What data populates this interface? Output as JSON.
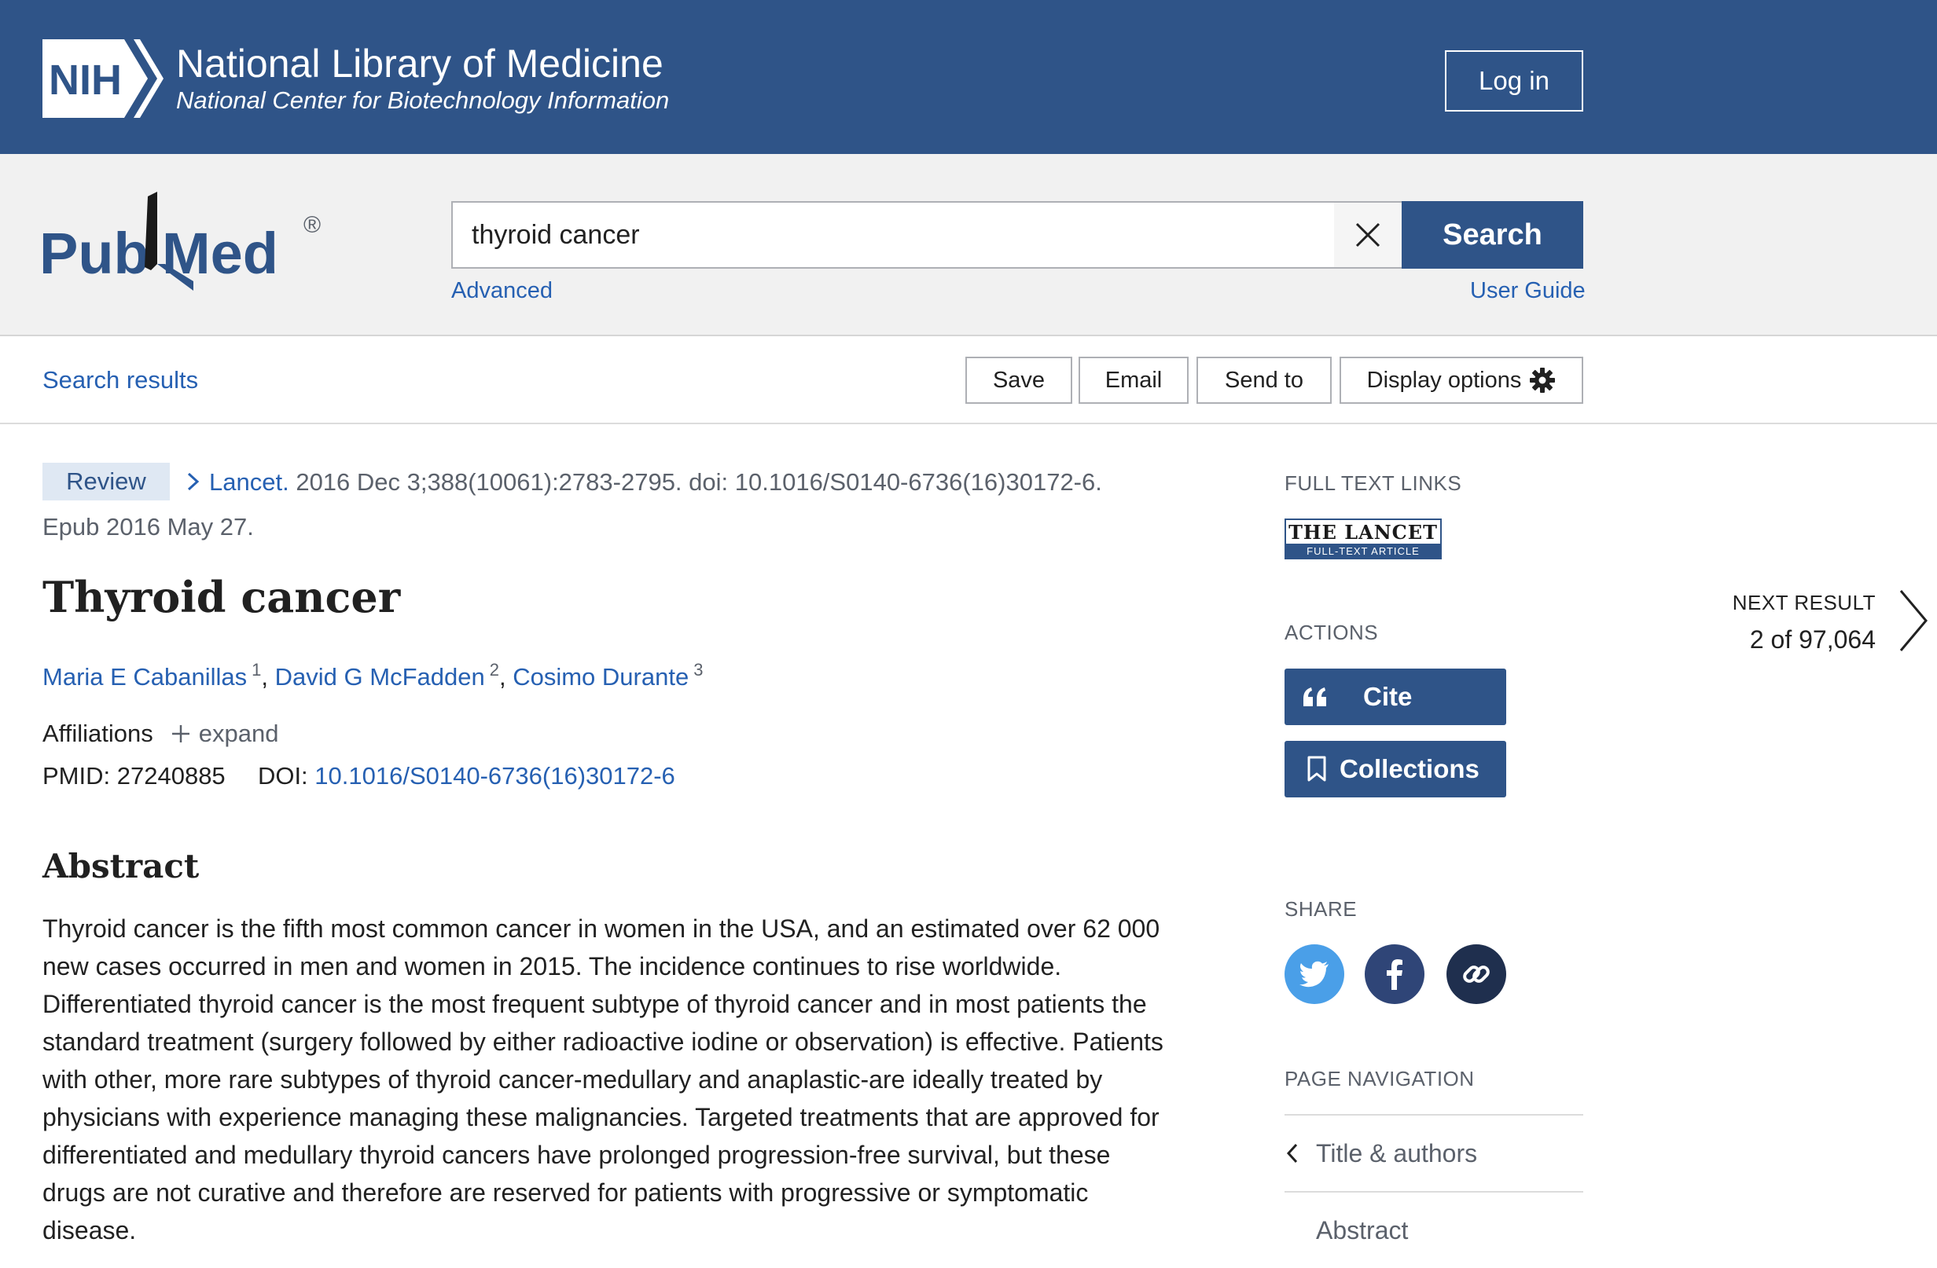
{
  "header": {
    "org_abbr": "NIH",
    "title": "National Library of Medicine",
    "subtitle": "National Center for Biotechnology Information",
    "login_label": "Log in",
    "brand_color": "#2f5488"
  },
  "search": {
    "logo_text": "PubMed",
    "logo_mark": "®",
    "query": "thyroid cancer",
    "button_label": "Search",
    "advanced_label": "Advanced",
    "user_guide_label": "User Guide"
  },
  "toolbar": {
    "search_results_label": "Search results",
    "save_label": "Save",
    "email_label": "Email",
    "send_to_label": "Send to",
    "display_options_label": "Display options"
  },
  "article": {
    "type_badge": "Review",
    "journal": "Lancet.",
    "citation": "2016 Dec 3;388(10061):2783-2795. doi: 10.1016/S0140-6736(16)30172-6.",
    "epub": "Epub 2016 May 27.",
    "title": "Thyroid cancer",
    "authors": [
      {
        "name": "Maria E Cabanillas",
        "affil": "1"
      },
      {
        "name": "David G McFadden",
        "affil": "2"
      },
      {
        "name": "Cosimo Durante",
        "affil": "3"
      }
    ],
    "affiliations_label": "Affiliations",
    "expand_label": "expand",
    "pmid_label": "PMID:",
    "pmid": "27240885",
    "doi_label": "DOI:",
    "doi": "10.1016/S0140-6736(16)30172-6",
    "abstract_heading": "Abstract",
    "abstract_text": "Thyroid cancer is the fifth most common cancer in women in the USA, and an estimated over 62 000 new cases occurred in men and women in 2015. The incidence continues to rise worldwide. Differentiated thyroid cancer is the most frequent subtype of thyroid cancer and in most patients the standard treatment (surgery followed by either radioactive iodine or observation) is effective. Patients with other, more rare subtypes of thyroid cancer-medullary and anaplastic-are ideally treated by physicians with experience managing these malignancies. Targeted treatments that are approved for differentiated and medullary thyroid cancers have prolonged progression-free survival, but these drugs are not curative and therefore are reserved for patients with progressive or symptomatic disease."
  },
  "sidebar": {
    "full_text_links_label": "FULL TEXT LINKS",
    "lancet_logo_top": "THE LANCET",
    "lancet_logo_bottom": "FULL-TEXT ARTICLE",
    "actions_label": "ACTIONS",
    "cite_label": "Cite",
    "collections_label": "Collections",
    "share_label": "SHARE",
    "twitter_color": "#4a9fe8",
    "facebook_color": "#2f4577",
    "link_color": "#1f2f4e",
    "page_navigation_label": "PAGE NAVIGATION",
    "nav_items": [
      "Title & authors",
      "Abstract"
    ]
  },
  "next_result": {
    "label": "NEXT RESULT",
    "count": "2 of 97,064"
  }
}
